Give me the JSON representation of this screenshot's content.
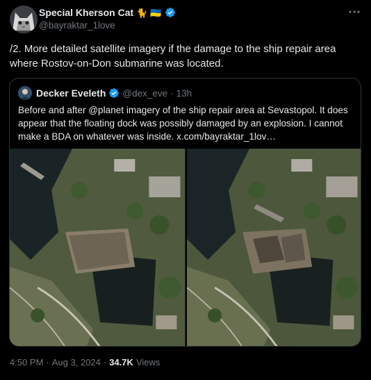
{
  "author": {
    "display_name": "Special Kherson Cat",
    "badge_emoji": "🐈",
    "flag_emoji": "🇺🇦",
    "handle": "@bayraktar_1love"
  },
  "tweet": {
    "text": "/2. More detailed satellite imagery if the damage to the ship repair area where Rostov-on-Don submarine was located."
  },
  "quoted": {
    "display_name": "Decker Eveleth",
    "handle": "@dex_eve",
    "separator": "·",
    "time": "13h",
    "text": "Before and after @planet imagery of the ship repair area at Sevastopol. It does appear that the floating dock was possibly damaged by an explosion. I cannot make a BDA on whatever was inside.  x.com/bayraktar_1lov…"
  },
  "meta": {
    "time": "4:50 PM",
    "separator": "·",
    "date": "Aug 3, 2024",
    "views_count": "34.7K",
    "views_label": "Views"
  },
  "colors": {
    "background": "#000000",
    "text": "#e7e9ea",
    "muted": "#71767b",
    "border": "#2f3336",
    "verified": "#1d9bf0"
  },
  "icons": [
    "verified-badge-icon",
    "more-options-icon"
  ]
}
